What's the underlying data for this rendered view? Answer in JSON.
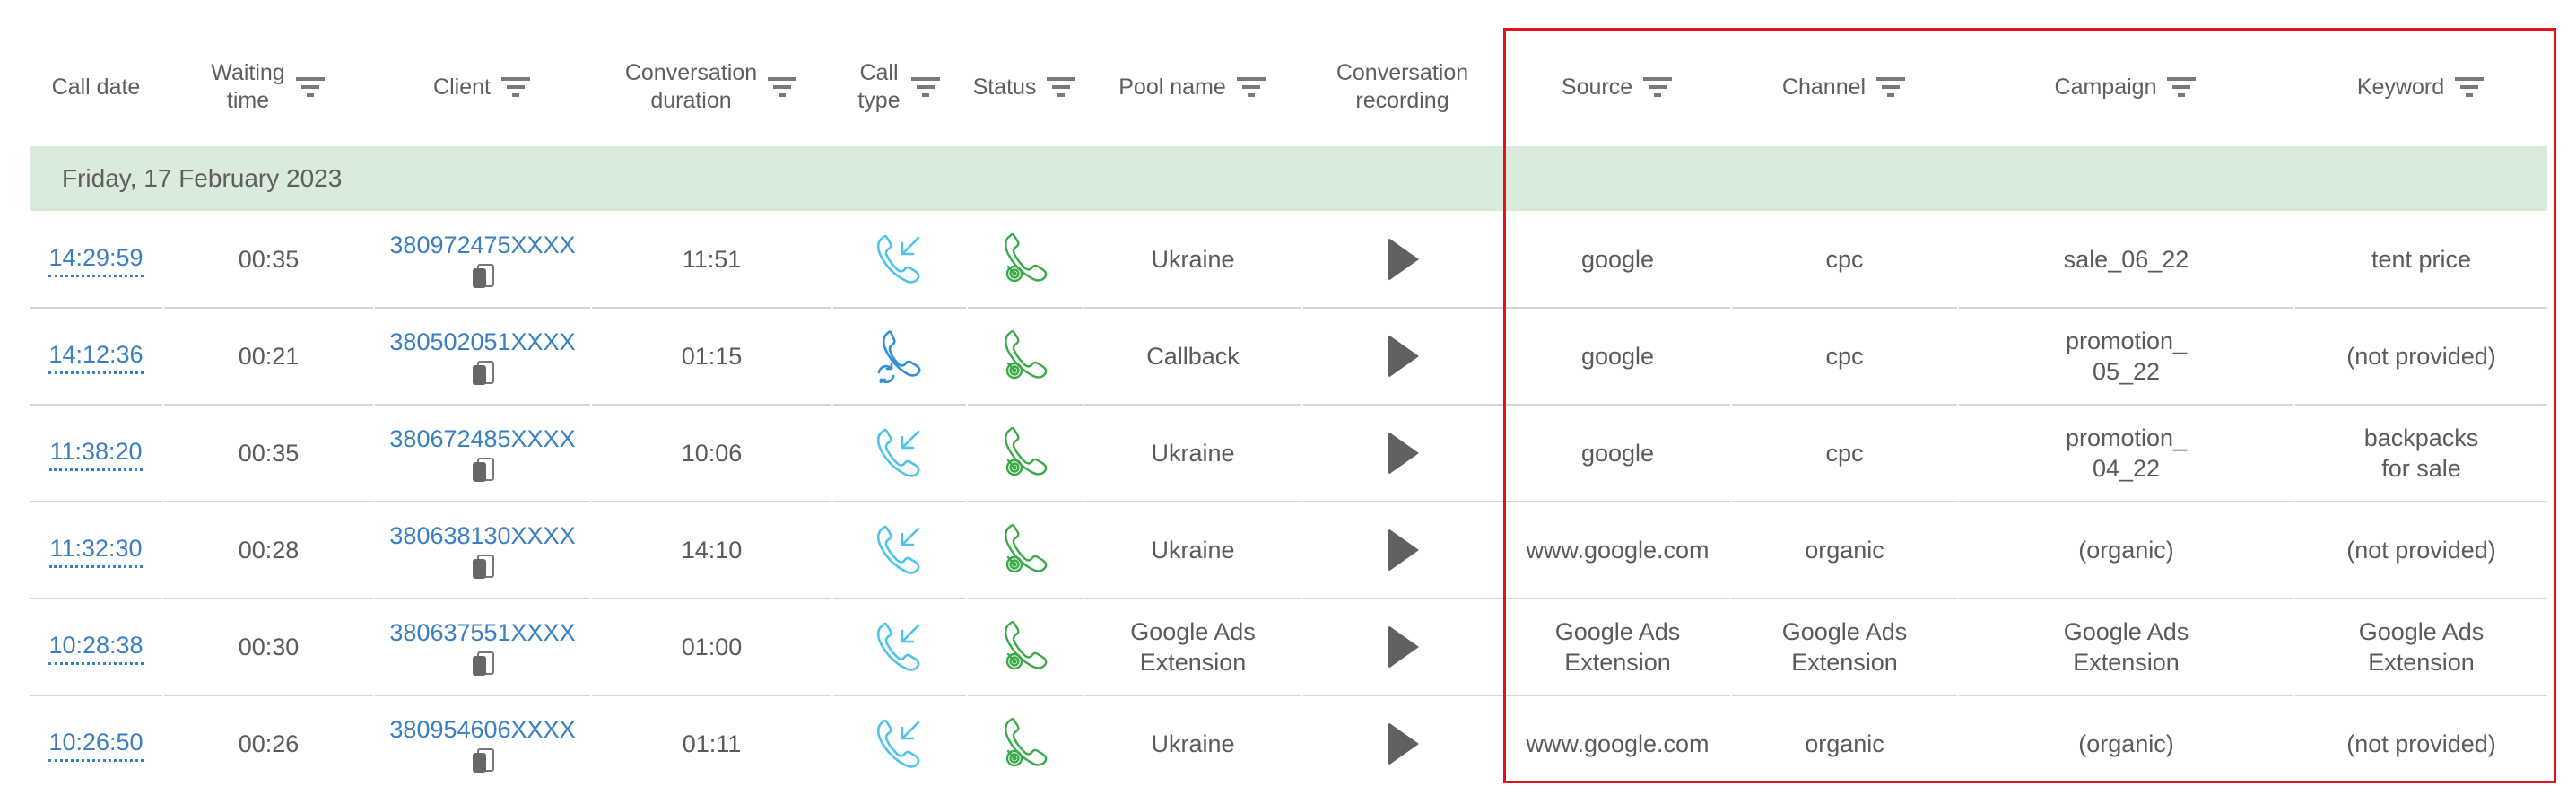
{
  "colors": {
    "link": "#3a7fc1",
    "date_bar": "#d9ecdb",
    "call_type_incoming": "#4fc3ec",
    "call_type_callback": "#2f8fd8",
    "status_answered": "#3aaa48",
    "highlight_box": "#e3111b"
  },
  "header": {
    "columns": [
      {
        "key": "call_date",
        "label": "Call date",
        "filter": false
      },
      {
        "key": "waiting_time",
        "label": "Waiting\ntime",
        "filter": true
      },
      {
        "key": "client",
        "label": "Client",
        "filter": true
      },
      {
        "key": "conversation_duration",
        "label": "Conversation\nduration",
        "filter": true
      },
      {
        "key": "call_type",
        "label": "Call\ntype",
        "filter": true
      },
      {
        "key": "status",
        "label": "Status",
        "filter": true
      },
      {
        "key": "pool_name",
        "label": "Pool name",
        "filter": true
      },
      {
        "key": "conversation_recording",
        "label": "Conversation\nrecording",
        "filter": false
      },
      {
        "key": "source",
        "label": "Source",
        "filter": true
      },
      {
        "key": "channel",
        "label": "Channel",
        "filter": true
      },
      {
        "key": "campaign",
        "label": "Campaign",
        "filter": true
      },
      {
        "key": "keyword",
        "label": "Keyword",
        "filter": true
      }
    ],
    "filter_icon": "filter-icon"
  },
  "date_group": {
    "label": "Friday, 17 February 2023"
  },
  "rows": [
    {
      "time": "14:29:59",
      "waiting": "00:35",
      "client": "380972475XXXX",
      "duration": "11:51",
      "call_type": "incoming",
      "call_type_icon": "incoming-call-icon",
      "status": "answered",
      "status_icon": "answered-call-icon",
      "pool": "Ukraine",
      "source": "google",
      "channel": "cpc",
      "campaign": "sale_06_22",
      "keyword": "tent price"
    },
    {
      "time": "14:12:36",
      "waiting": "00:21",
      "client": "380502051XXXX",
      "duration": "01:15",
      "call_type": "callback",
      "call_type_icon": "callback-call-icon",
      "status": "answered",
      "status_icon": "answered-call-icon",
      "pool": "Callback",
      "source": "google",
      "channel": "cpc",
      "campaign": "promotion_\n05_22",
      "keyword": "(not provided)"
    },
    {
      "time": "11:38:20",
      "waiting": "00:35",
      "client": "380672485XXXX",
      "duration": "10:06",
      "call_type": "incoming",
      "call_type_icon": "incoming-call-icon",
      "status": "answered",
      "status_icon": "answered-call-icon",
      "pool": "Ukraine",
      "source": "google",
      "channel": "cpc",
      "campaign": "promotion_\n04_22",
      "keyword": "backpacks\nfor sale"
    },
    {
      "time": "11:32:30",
      "waiting": "00:28",
      "client": "380638130XXXX",
      "duration": "14:10",
      "call_type": "incoming",
      "call_type_icon": "incoming-call-icon",
      "status": "answered",
      "status_icon": "answered-call-icon",
      "pool": "Ukraine",
      "source": "www.google.com",
      "channel": "organic",
      "campaign": "(organic)",
      "keyword": "(not provided)"
    },
    {
      "time": "10:28:38",
      "waiting": "00:30",
      "client": "380637551XXXX",
      "duration": "01:00",
      "call_type": "incoming",
      "call_type_icon": "incoming-call-icon",
      "status": "answered",
      "status_icon": "answered-call-icon",
      "pool": "Google Ads\nExtension",
      "source": "Google Ads\nExtension",
      "channel": "Google Ads\nExtension",
      "campaign": "Google Ads\nExtension",
      "keyword": "Google Ads\nExtension"
    },
    {
      "time": "10:26:50",
      "waiting": "00:26",
      "client": "380954606XXXX",
      "duration": "01:11",
      "call_type": "incoming",
      "call_type_icon": "incoming-call-icon",
      "status": "answered",
      "status_icon": "answered-call-icon",
      "pool": "Ukraine",
      "source": "www.google.com",
      "channel": "organic",
      "campaign": "(organic)",
      "keyword": "(not provided)"
    }
  ]
}
